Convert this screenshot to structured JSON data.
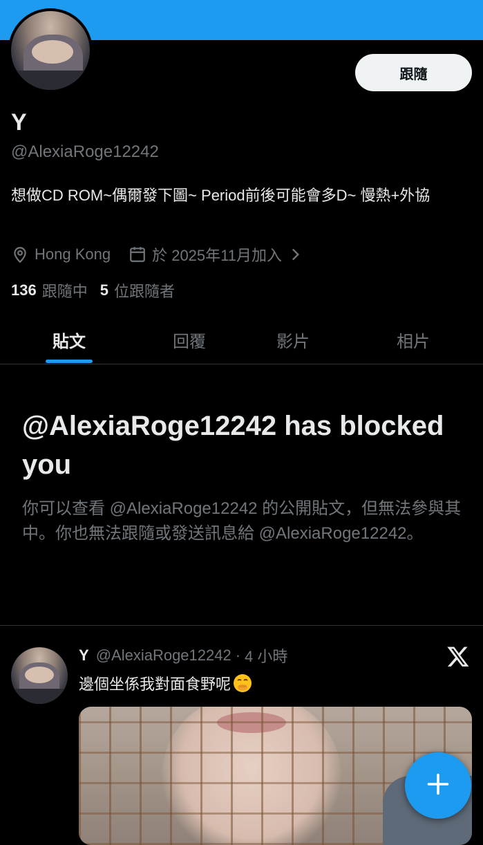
{
  "profile": {
    "display_name": "Y",
    "handle": "@AlexiaRoge12242",
    "follow_label": "跟隨",
    "bio": "想做CD ROM~偶爾發下圖~ Period前後可能會多D~ 慢熱+外協",
    "location": "Hong Kong",
    "joined": "於 2025年11月加入",
    "following_count": "136",
    "following_label": "跟隨中",
    "followers_count": "5",
    "followers_label": "位跟隨者"
  },
  "tabs": [
    {
      "label": "貼文",
      "active": true
    },
    {
      "label": "回覆",
      "active": false
    },
    {
      "label": "影片",
      "active": false
    },
    {
      "label": "相片",
      "active": false
    }
  ],
  "blocked": {
    "title": "@AlexiaRoge12242 has blocked you",
    "description": "你可以查看 @AlexiaRoge12242 的公開貼文，但無法參與其中。你也無法跟隨或發送訊息給 @AlexiaRoge12242。"
  },
  "post": {
    "name": "Y",
    "handle": "@AlexiaRoge12242",
    "separator": "·",
    "time": "4 小時",
    "text": "邊個坐係我對面食野呢"
  },
  "icons": {
    "location": "location-pin-icon",
    "calendar": "calendar-icon",
    "chevron": "chevron-right-icon",
    "x_logo": "x-logo-icon",
    "compose": "plus-icon",
    "emoji": "face-with-hand-over-mouth-emoji"
  },
  "colors": {
    "accent": "#1d9bf0",
    "background": "#000000",
    "text_primary": "#e7e9ea",
    "text_secondary": "#71767b"
  }
}
